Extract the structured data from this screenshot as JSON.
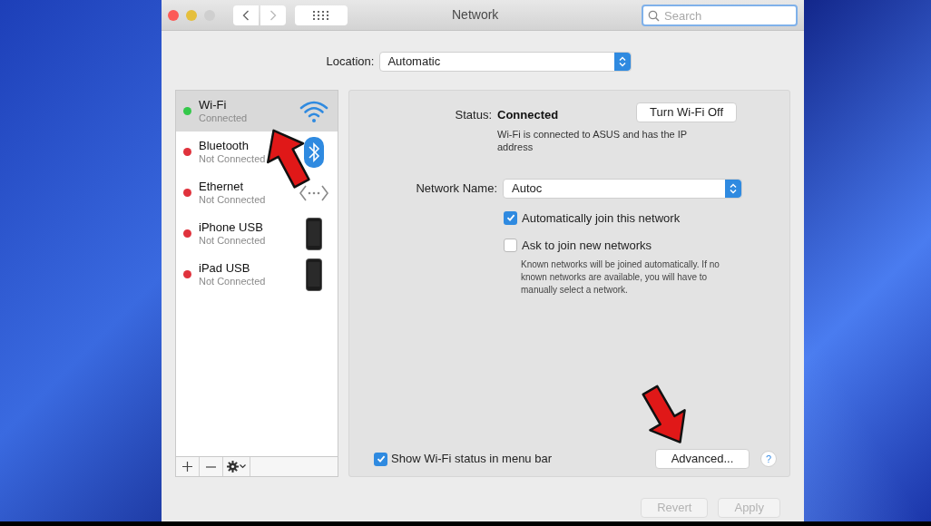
{
  "window": {
    "title": "Network"
  },
  "search": {
    "placeholder": "Search"
  },
  "location": {
    "label": "Location:",
    "value": "Automatic"
  },
  "services": [
    {
      "name": "Wi-Fi",
      "status": "Connected",
      "color": "#34c84a",
      "kind": "wifi",
      "selected": true
    },
    {
      "name": "Bluetooth",
      "status": "Not Connected",
      "color": "#e0323c",
      "kind": "bluetooth",
      "selected": false
    },
    {
      "name": "Ethernet",
      "status": "Not Connected",
      "color": "#e0323c",
      "kind": "ethernet",
      "selected": false
    },
    {
      "name": "iPhone USB",
      "status": "Not Connected",
      "color": "#e0323c",
      "kind": "phone",
      "selected": false
    },
    {
      "name": "iPad USB",
      "status": "Not Connected",
      "color": "#e0323c",
      "kind": "phone",
      "selected": false
    }
  ],
  "detail": {
    "status_label": "Status:",
    "status_value": "Connected",
    "toggle_button": "Turn Wi-Fi Off",
    "status_description": "Wi-Fi is connected to ASUS and has the IP address",
    "network_name_label": "Network Name:",
    "network_name_value": "Autoc",
    "options": [
      {
        "label": "Automatically join this network",
        "checked": true
      },
      {
        "label": "Ask to join new networks",
        "checked": false
      }
    ],
    "note": "Known networks will be joined automatically. If no known networks are available, you will have to manually select a network.",
    "show_status": {
      "label": "Show Wi-Fi status in menu bar",
      "checked": true
    },
    "advanced_button": "Advanced...",
    "help": "?"
  },
  "footer_buttons": [
    {
      "label": "Revert",
      "disabled": true
    },
    {
      "label": "Apply",
      "disabled": true
    }
  ]
}
